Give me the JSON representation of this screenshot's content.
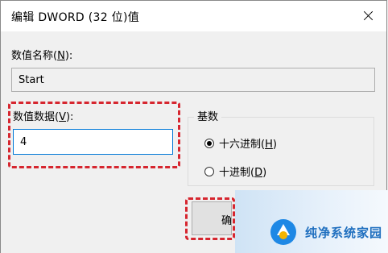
{
  "dialog": {
    "title": "编辑 DWORD (32 位)值",
    "close_icon": "close-icon"
  },
  "value_name": {
    "label_prefix": "数值名称(",
    "accesskey": "N",
    "label_suffix": "):",
    "value": "Start"
  },
  "value_data": {
    "label_prefix": "数值数据(",
    "accesskey": "V",
    "label_suffix": "):",
    "value": "4"
  },
  "base": {
    "title": "基数",
    "options": [
      {
        "label_prefix": "十六进制(",
        "accesskey": "H",
        "label_suffix": ")",
        "selected": true
      },
      {
        "label_prefix": "十进制(",
        "accesskey": "D",
        "label_suffix": ")",
        "selected": false
      }
    ]
  },
  "ok_button": {
    "partial_label": "确"
  },
  "highlight_color": "#d6262f",
  "watermark": {
    "text": "纯净系统家园",
    "icon": "brand-logo"
  }
}
